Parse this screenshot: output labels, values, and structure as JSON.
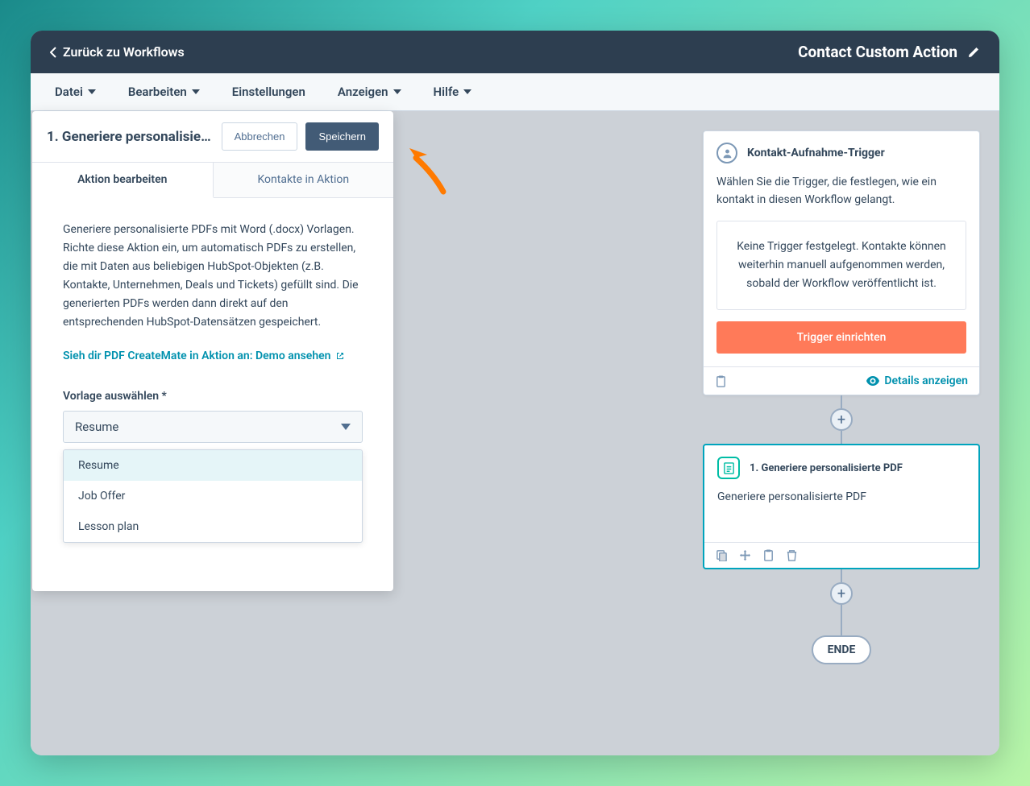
{
  "titlebar": {
    "back": "Zurück zu Workflows",
    "title": "Contact Custom Action"
  },
  "menubar": {
    "file": "Datei",
    "edit": "Bearbeiten",
    "settings": "Einstellungen",
    "view": "Anzeigen",
    "help": "Hilfe"
  },
  "panel": {
    "title": "1. Generiere personalisierte…",
    "cancel": "Abbrechen",
    "save": "Speichern",
    "tabs": {
      "edit": "Aktion bearbeiten",
      "contacts": "Kontakte in Aktion"
    },
    "description": "Generiere personalisierte PDFs mit Word (.docx) Vorlagen. Richte diese Aktion ein, um automatisch PDFs zu erstellen, die mit Daten aus beliebigen HubSpot-Objekten (z.B. Kontakte, Unternehmen, Deals und Tickets) gefüllt sind. Die generierten PDFs werden dann direkt auf den entsprechenden HubSpot-Datensätzen gespeichert.",
    "demo_link": "Sieh dir PDF CreateMate in Aktion an: Demo ansehen",
    "template_label": "Vorlage auswählen *",
    "template_selected": "Resume",
    "template_options": [
      "Resume",
      "Job Offer",
      "Lesson plan"
    ]
  },
  "canvas": {
    "trigger": {
      "title": "Kontakt-Aufnahme-Trigger",
      "desc": "Wählen Sie die Trigger, die festlegen, wie ein kontakt in diesen Workflow gelangt.",
      "empty": "Keine Trigger festgelegt. Kontakte können weiterhin manuell aufgenommen werden, sobald der Workflow veröffentlicht ist.",
      "setup_btn": "Trigger einrichten",
      "details": "Details anzeigen"
    },
    "action": {
      "title": "1. Generiere personalisierte PDF",
      "body": "Generiere personalisierte PDF"
    },
    "end": "ENDE"
  }
}
